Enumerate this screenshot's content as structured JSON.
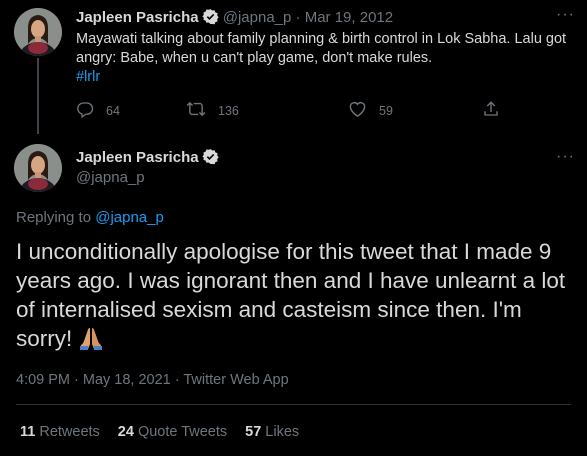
{
  "parent_tweet": {
    "author_name": "Japleen Pasricha",
    "handle": "@japna_p",
    "separator": "·",
    "date": "Mar 19, 2012",
    "text": "Mayawati talking about family planning & birth control in Lok Sabha. Lalu got angry: Babe, when u can't play game, don't make rules.",
    "hashtag": "#lrlr",
    "replies": "64",
    "retweets": "136",
    "likes": "59",
    "more_label": "···"
  },
  "main_tweet": {
    "author_name": "Japleen Pasricha",
    "handle": "@japna_p",
    "more_label": "···",
    "replying_prefix": "Replying to",
    "replying_to": "@japna_p",
    "text": "I unconditionally apologise for this tweet that I made 9 years ago. I was ignorant then and I have unlearnt a lot of internalised sexism and casteism since then. I'm sorry!",
    "emoji": "folded-hands-emoji",
    "timestamp": "4:09 PM · May 18, 2021 · Twitter Web App",
    "stats": {
      "retweets_count": "11",
      "retweets_label": "Retweets",
      "quote_count": "24",
      "quote_label": "Quote Tweets",
      "likes_count": "57",
      "likes_label": "Likes"
    }
  },
  "colors": {
    "background": "#000000",
    "text": "#d9d9d9",
    "muted": "#6e767d",
    "accent": "#1d9bf0"
  },
  "icons": [
    "verified-badge-icon",
    "reply-icon",
    "retweet-icon",
    "like-icon",
    "share-icon",
    "more-icon"
  ]
}
